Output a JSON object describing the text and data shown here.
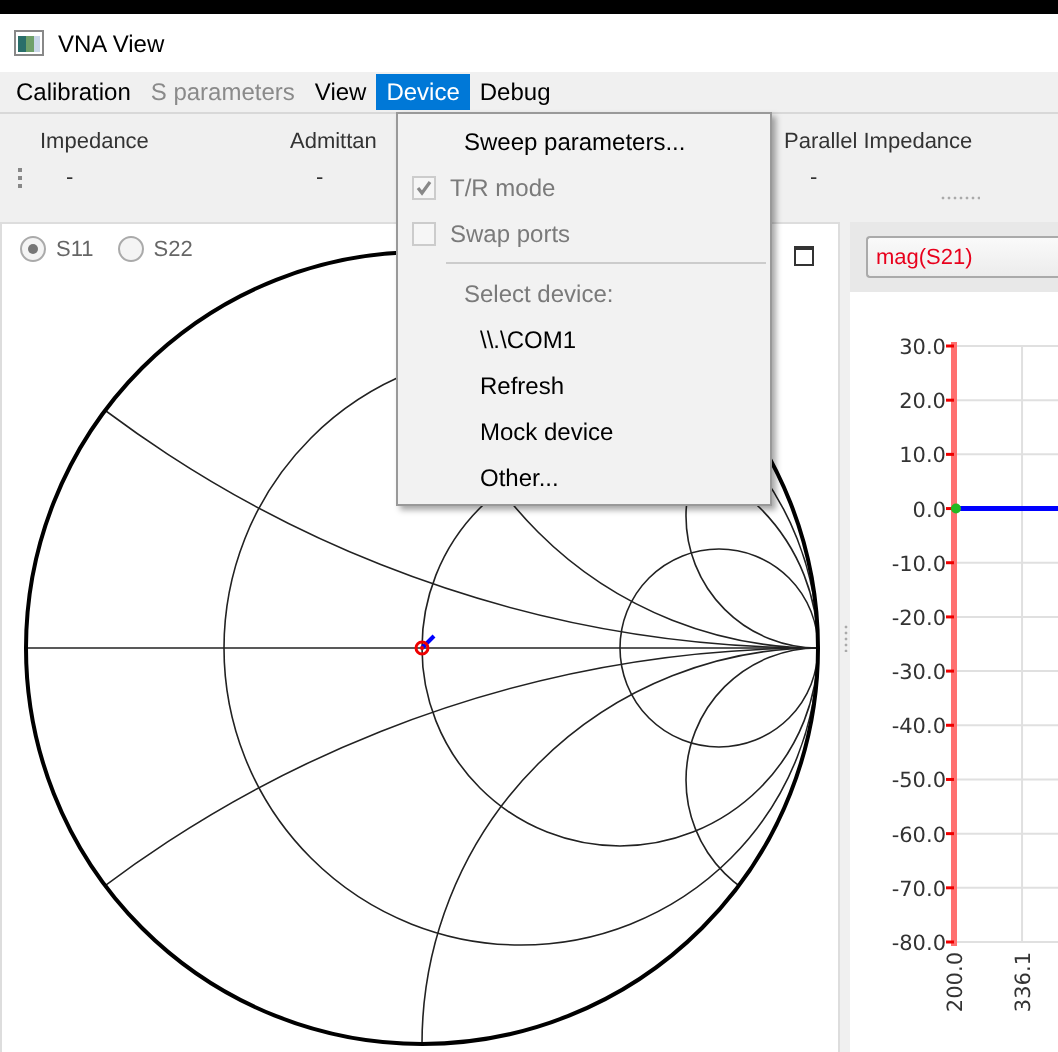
{
  "window": {
    "title": "VNA View"
  },
  "menu_bar": [
    {
      "label": "Calibration",
      "disabled": false,
      "selected": false
    },
    {
      "label": "S parameters",
      "disabled": true,
      "selected": false
    },
    {
      "label": "View",
      "disabled": false,
      "selected": false
    },
    {
      "label": "Device",
      "disabled": false,
      "selected": true
    },
    {
      "label": "Debug",
      "disabled": false,
      "selected": false
    }
  ],
  "readouts": [
    {
      "label": "Impedance",
      "value": "-"
    },
    {
      "label": "Admittan",
      "value": "-"
    },
    {
      "label": "Parallel Impedance",
      "value": "-"
    }
  ],
  "smith_panel": {
    "ports": [
      {
        "label": "S11",
        "selected": true
      },
      {
        "label": "S22",
        "selected": false
      }
    ]
  },
  "graph_panel": {
    "chart_data": {
      "type": "line",
      "grid": true,
      "xlim": [
        200.0,
        408.0
      ],
      "x": [
        200.0,
        408.0
      ],
      "xticks": [
        {
          "value": 200.0,
          "label": "200.0"
        },
        {
          "value": 336.1,
          "label": "336.1"
        }
      ],
      "ylim": [
        -80,
        30
      ],
      "yticks": [
        {
          "value": 30,
          "label": "30.0"
        },
        {
          "value": 20,
          "label": "20.0"
        },
        {
          "value": 10,
          "label": "10.0"
        },
        {
          "value": 0,
          "label": "0.0"
        },
        {
          "value": -10,
          "label": "-10.0"
        },
        {
          "value": -20,
          "label": "-20.0"
        },
        {
          "value": -30,
          "label": "-30.0"
        },
        {
          "value": -40,
          "label": "-40.0"
        },
        {
          "value": -50,
          "label": "-50.0"
        },
        {
          "value": -60,
          "label": "-60.0"
        },
        {
          "value": -70,
          "label": "-70.0"
        },
        {
          "value": -80,
          "label": "-80.0"
        }
      ],
      "series": [
        {
          "name": "mag(S21)",
          "color": "#0000ff",
          "values": [
            0,
            0
          ]
        }
      ]
    }
  },
  "device_menu": [
    {
      "kind": "action",
      "label": "Sweep parameters...",
      "disabled": false
    },
    {
      "kind": "check",
      "label": "T/R mode",
      "checked": true,
      "disabled": true
    },
    {
      "kind": "check",
      "label": "Swap ports",
      "checked": false,
      "disabled": true
    },
    {
      "kind": "separator"
    },
    {
      "kind": "heading",
      "label": "Select device:"
    },
    {
      "kind": "device",
      "label": "\\\\.\\COM1",
      "disabled": false
    },
    {
      "kind": "device",
      "label": "Refresh",
      "disabled": false
    },
    {
      "kind": "device",
      "label": "Mock device",
      "disabled": false
    },
    {
      "kind": "device",
      "label": "Other...",
      "disabled": false
    }
  ]
}
